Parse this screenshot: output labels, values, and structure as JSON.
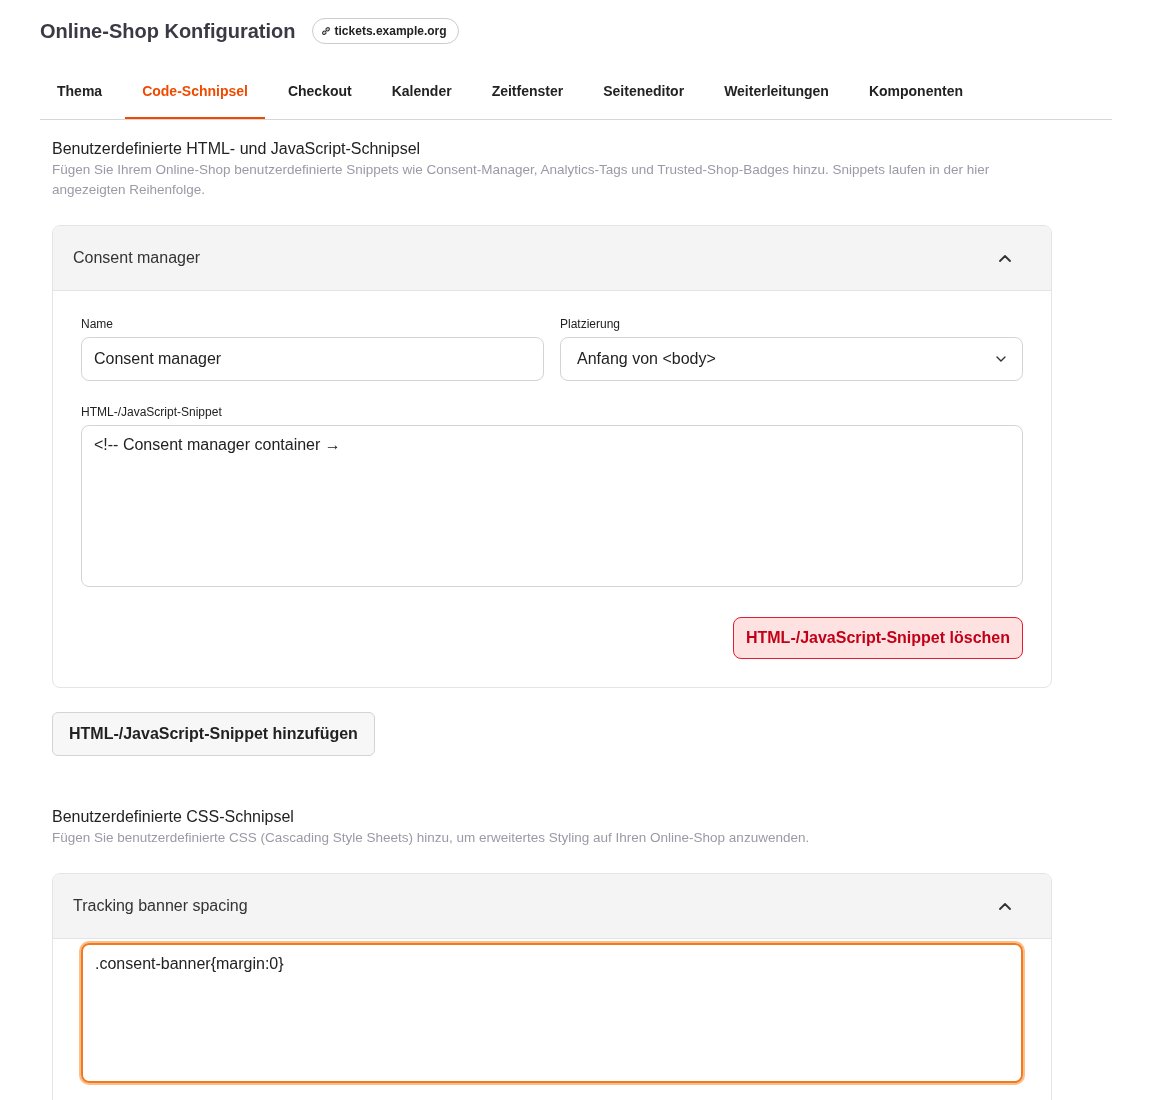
{
  "page": {
    "title": "Online-Shop Konfiguration",
    "domain_badge": "tickets.example.org"
  },
  "tabs": [
    {
      "label": "Thema",
      "selected": false
    },
    {
      "label": "Code-Schnipsel",
      "selected": true
    },
    {
      "label": "Checkout",
      "selected": false
    },
    {
      "label": "Kalender",
      "selected": false
    },
    {
      "label": "Zeitfenster",
      "selected": false
    },
    {
      "label": "Seiteneditor",
      "selected": false
    },
    {
      "label": "Weiterleitungen",
      "selected": false
    },
    {
      "label": "Komponenten",
      "selected": false
    }
  ],
  "sections": [
    {
      "heading": "Benutzerdefinierte HTML- und JavaScript-Schnipsel",
      "description": "Fügen Sie Ihrem Online-Shop benutzerdefinierte Snippets wie Consent-Manager, Analytics-Tags und Trusted-Shop-Badges hinzu. Snippets laufen in der hier angezeigten Reihenfolge.",
      "cards": [
        {
          "title": "Consent manager",
          "expanded": true,
          "name_label": "Name",
          "name_value": "Consent manager",
          "placement_label": "Platzierung",
          "placement_value": "Anfang von <body>",
          "code_label": "HTML-/JavaScript-Snippet",
          "code_value": "<!-- Consent manager container →",
          "code_focused": false,
          "delete_button": "HTML-/JavaScript-Snippet löschen"
        }
      ],
      "add_button": "HTML-/JavaScript-Snippet hinzufügen"
    },
    {
      "heading": "Benutzerdefinierte CSS-Schnipsel",
      "description": "Fügen Sie benutzerdefinierte CSS (Cascading Style Sheets) hinzu, um erweitertes Styling auf Ihren Online-Shop anzuwenden.",
      "cards": [
        {
          "title": "Tracking banner spacing",
          "expanded": true,
          "code_value": ".consent-banner{margin:0}",
          "code_focused": true
        }
      ]
    }
  ]
}
